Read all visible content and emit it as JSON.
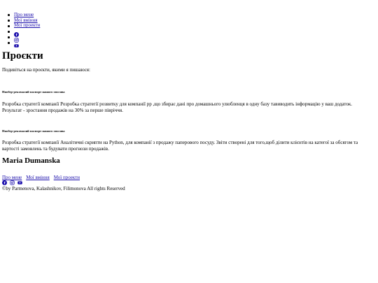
{
  "nav": {
    "items": [
      {
        "label": "Про мене"
      },
      {
        "label": "Мої вміння"
      },
      {
        "label": "Мої проекти"
      }
    ],
    "icons": [
      "facebook-icon",
      "instagram-icon",
      "youtube-icon"
    ]
  },
  "main": {
    "title": "Проєкти",
    "intro": "Подивіться на проєкти, якими я пишаюся:",
    "projects": [
      {
        "title": "Ниобер-рекомалий паспорт нашого хвосява",
        "description": "Розробка стратегії компанії Розробка стратегії розвитку для компанії pp ,що збирає дані про домашнього улюбленця в одну базу тавиводить інформацію у ваш додаток. Результат - зростання продажів на 30% за перше півріччя."
      },
      {
        "title": "Ниобер-рекомалий паспорт нашого хвосява",
        "description": "Розробка стратегії компанії Аналітичні скрипти на Python, для компанії з продажу паперового посуду. Звіти створені для того,щоб ділити клієнтів на категої за обсягом та вартості замовлень та будувати прогнози продажів."
      }
    ]
  },
  "footer": {
    "name": "Maria Dumanska",
    "links": [
      {
        "label": "Про мене"
      },
      {
        "label": "Мої вміння"
      },
      {
        "label": "Мої проекти"
      }
    ],
    "copyright": "©by Parmenova, Kalashnikov, Filimonova All rights Reserved"
  },
  "colors": {
    "link": "#1a0dab",
    "text": "#000000",
    "background": "#ffffff"
  }
}
